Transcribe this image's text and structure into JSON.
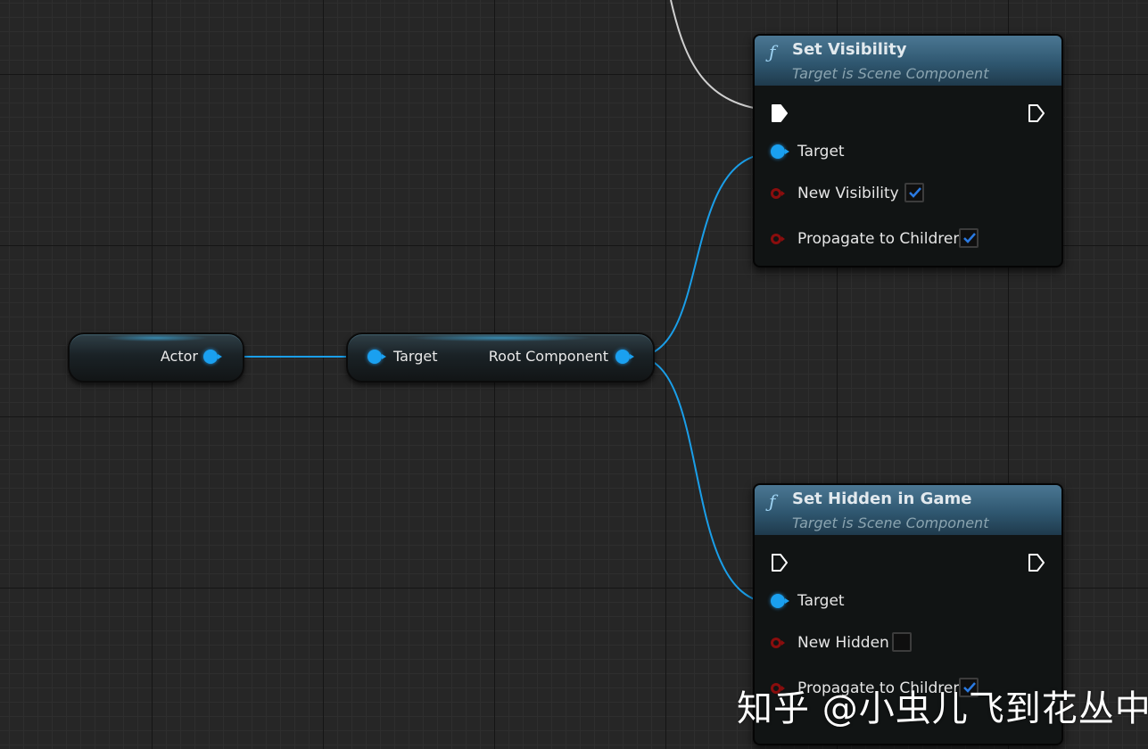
{
  "actor_node": {
    "output_label": "Actor"
  },
  "get_root_node": {
    "input_label": "Target",
    "output_label": "Root Component"
  },
  "set_visibility": {
    "title": "Set Visibility",
    "subtitle": "Target is Scene Component",
    "target_label": "Target",
    "new_visibility_label": "New Visibility",
    "new_visibility_checked": true,
    "propagate_label": "Propagate to Children",
    "propagate_checked": true
  },
  "set_hidden_in_game": {
    "title": "Set Hidden in Game",
    "subtitle": "Target is Scene Component",
    "target_label": "Target",
    "new_hidden_label": "New Hidden",
    "new_hidden_checked": false,
    "propagate_label": "Propagate to Children",
    "propagate_checked": true
  },
  "icons": {
    "function": "function-icon",
    "exec": "exec-pin-icon",
    "object": "object-pin-icon",
    "bool": "bool-pin-icon"
  },
  "colors": {
    "object_pin": "#1aa0f0",
    "bool_pin": "#8a0d0d",
    "exec_wire": "#d0d0d0",
    "checkbox_tick": "#2a7ae2"
  },
  "watermark": "知乎 @小虫儿飞到花丛中"
}
